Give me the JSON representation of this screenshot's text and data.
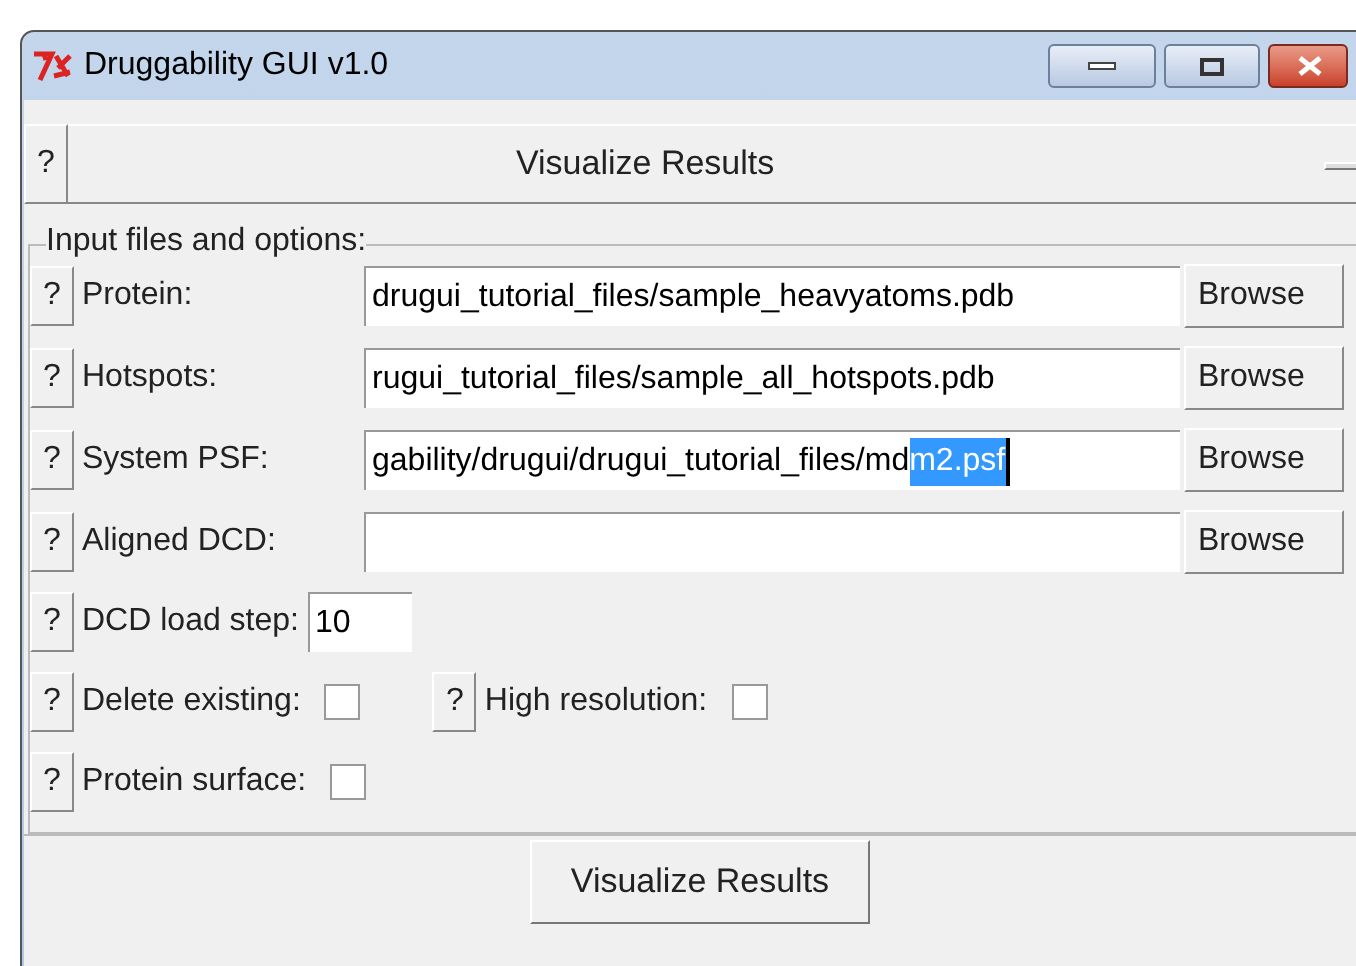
{
  "window": {
    "title": "Druggability GUI v1.0"
  },
  "header": {
    "help": "?",
    "title": "Visualize Results"
  },
  "group": {
    "title": "Input files and options:"
  },
  "file_rows": [
    {
      "help": "?",
      "label": "Protein:",
      "value": "drugui_tutorial_files/sample_heavyatoms.pdb",
      "selected_part": "",
      "browse": "Browse"
    },
    {
      "help": "?",
      "label": "Hotspots:",
      "value": "rugui_tutorial_files/sample_all_hotspots.pdb",
      "selected_part": "",
      "browse": "Browse"
    },
    {
      "help": "?",
      "label": "System PSF:",
      "value": "gability/drugui/drugui_tutorial_files/md",
      "selected_part": "m2.psf",
      "browse": "Browse"
    },
    {
      "help": "?",
      "label": "Aligned DCD:",
      "value": "",
      "selected_part": "",
      "browse": "Browse"
    }
  ],
  "load_step": {
    "help": "?",
    "label": "DCD load step:",
    "value": "10"
  },
  "options": [
    [
      {
        "help": "?",
        "label": "Delete existing:",
        "checked": false
      },
      {
        "help": "?",
        "label": "High resolution:",
        "checked": false
      }
    ],
    [
      {
        "help": "?",
        "label": "Protein surface:",
        "checked": false
      }
    ]
  ],
  "submit": "Visualize Results"
}
